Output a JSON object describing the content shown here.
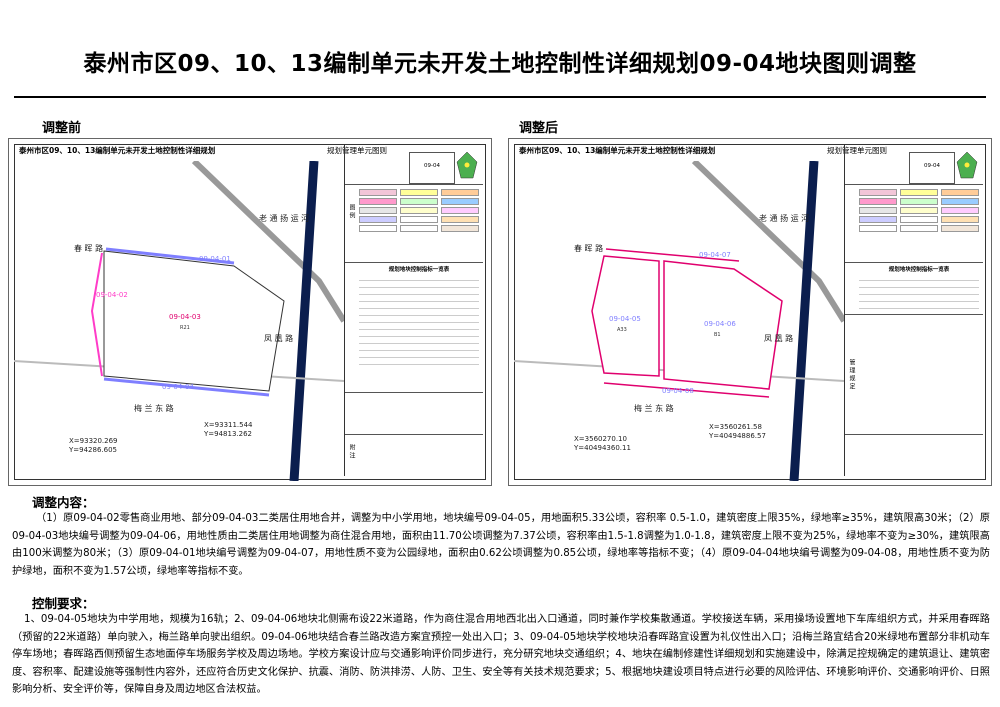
{
  "title": "泰州市区09、10、13编制单元未开发土地控制性详细规划09-04地块图则调整",
  "before": {
    "label": "调整前",
    "sheet_title": "泰州市区09、10、13编制单元未开发土地控制性详细规划",
    "sheet_sub": "规划管理单元图则",
    "unit_code": "09-04",
    "roads": {
      "old_tong_yang": "老 通 扬 运 河",
      "chunhui": "春 晖 路",
      "meilan": "梅 兰 东 路",
      "fengqiu": "凤 凰 路"
    },
    "parcels": [
      {
        "code": "09-04-01",
        "color": "#7f7fff"
      },
      {
        "code": "09-04-02",
        "color": "#ff3cc8"
      },
      {
        "code": "09-04-03",
        "color": "#e0006e",
        "sub": "R21"
      },
      {
        "code": "09-04-04",
        "color": "#7f7fff"
      }
    ],
    "coords": [
      {
        "x": "X=93320.269",
        "y": "Y=94286.605"
      },
      {
        "x": "X=93311.544",
        "y": "Y=94813.262"
      }
    ]
  },
  "after": {
    "label": "调整后",
    "sheet_title": "泰州市区09、10、13编制单元未开发土地控制性详细规划",
    "sheet_sub": "规划管理单元图则",
    "unit_code": "09-04",
    "roads": {
      "old_tong_yang": "老 通 扬 运 河",
      "chunhui": "春 晖 路",
      "meilan": "梅 兰 东 路",
      "fengqiu": "凤 凰 路"
    },
    "parcels": [
      {
        "code": "09-04-07",
        "color": "#e0006e"
      },
      {
        "code": "09-04-05",
        "color": "#e0006e",
        "sub": "A33"
      },
      {
        "code": "09-04-06",
        "color": "#e0006e",
        "sub": "B1"
      },
      {
        "code": "09-04-08",
        "color": "#e0006e"
      }
    ],
    "coords": [
      {
        "x": "X=3560270.10",
        "y": "Y=40494360.11"
      },
      {
        "x": "X=3560261.58",
        "y": "Y=40494886.57"
      }
    ]
  },
  "side_labels": [
    "管理单元",
    "图例",
    "规划用地指标",
    "管理规定",
    "附注"
  ],
  "side_table_title": "规划地块控制指标一览表",
  "content_heading": "调整内容：",
  "content_text": "（1）原09-04-02零售商业用地、部分09-04-03二类居住用地合并，调整为中小学用地，地块编号09-04-05，用地面积5.33公顷，容积率 0.5-1.0，建筑密度上限35%，绿地率≥35%，建筑限高30米；（2）原09-04-03地块编号调整为09-04-06，用地性质由二类居住用地调整为商住混合用地，面积由11.70公顷调整为7.37公顷，容积率由1.5-1.8调整为1.0-1.8，建筑密度上限不变为25%，绿地率不变为≥30%，建筑限高由100米调整为80米；（3）原09-04-01地块编号调整为09-04-07，用地性质不变为公园绿地，面积由0.62公顷调整为0.85公顷，绿地率等指标不变；（4）原09-04-04地块编号调整为09-04-08，用地性质不变为防护绿地，面积不变为1.57公顷，绿地率等指标不变。",
  "control_heading": "控制要求：",
  "control_text": "1、09-04-05地块为中学用地，规模为16轨；2、09-04-06地块北侧需布设22米道路，作为商住混合用地西北出入口通道，同时兼作学校集散通道。学校接送车辆，采用操场设置地下车库组织方式，并采用春晖路（预留的22米道路）单向驶入，梅兰路单向驶出组织。09-04-06地块结合春兰路改造方案宜预控一处出入口；3、09-04-05地块学校地块沿春晖路宜设置为礼仪性出入口；沿梅兰路宜结合20米绿地布置部分非机动车停车场地；春晖路西侧预留生态地面停车场服务学校及周边场地。学校方案设计应与交通影响评价同步进行，充分研究地块交通组织；4、地块在编制修建性详细规划和实施建设中，除满足控规确定的建筑退让、建筑密度、容积率、配建设施等强制性内容外，还应符合历史文化保护、抗震、消防、防洪排涝、人防、卫生、安全等有关技术规范要求；5、根据地块建设项目特点进行必要的风险评估、环境影响评价、交通影响评价、日照影响分析、安全评价等，保障自身及周边地区合法权益。"
}
